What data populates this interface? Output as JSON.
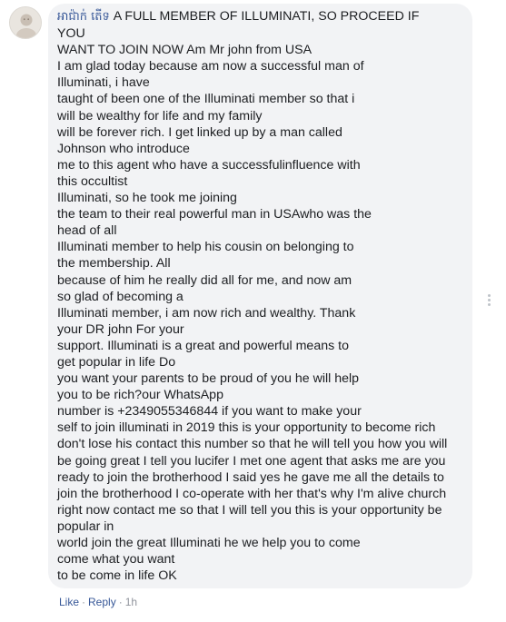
{
  "comment": {
    "author": "អាជ៉ាក់ តើទ",
    "lines": [
      "A FULL MEMBER OF ILLUMINATI, SO PROCEED IF",
      "YOU",
      "WANT TO JOIN NOW Am Mr john from USA",
      "I am glad today because am now a successful man of",
      "Illuminati, i have",
      "taught of been one of the Illuminati member so that i",
      "will be wealthy for life and my family",
      "will be forever rich. I get linked up by a man called",
      "Johnson who introduce",
      "me to this agent who have a successfulinfluence with",
      "this occultist",
      "Illuminati, so he took me joining",
      "the team to their real powerful man in USAwho was the",
      "head of all",
      "Illuminati member to help his cousin on belonging to",
      "the membership. All",
      "because of him he really did all for me, and now am",
      "so glad of becoming a",
      "Illuminati member, i am now rich and wealthy. Thank",
      "your DR john For your",
      "support. Illuminati is a great and powerful means to",
      "get popular in life Do",
      "you want your parents to be proud of you he will help",
      "you to be rich?our WhatsApp",
      "number is +2349055346844 if you want to make your",
      "self to join illuminati in 2019 this is your opportunity to become rich",
      "don't lose his contact this number so that he will tell you how you will",
      "be going great I tell you lucifer I met one agent that asks me are you",
      "ready to join the brotherhood I said yes he gave me all the details to",
      "join the brotherhood I co-operate with her that's why I'm alive church",
      "right now contact me so that I will tell you this is your opportunity be",
      "popular in",
      "world join the great Illuminati he we help you to come",
      "come what you want",
      "to be come in life OK"
    ]
  },
  "footer": {
    "like": "Like",
    "separator": "·",
    "reply": "Reply",
    "time": "1h"
  },
  "colors": {
    "bubble": "#f2f3f5",
    "text": "#1c1e21",
    "author": "#385898",
    "link": "#385898",
    "meta": "#90949c"
  }
}
